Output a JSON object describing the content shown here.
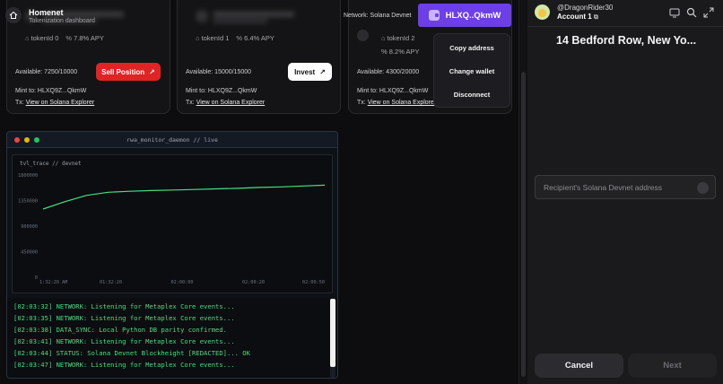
{
  "header": {
    "title": "Homenet",
    "subtitle": "Tokenization dashboard",
    "network_label": "Network: Solana Devnet",
    "wallet_button": "HLXQ..QkmW"
  },
  "wallet_menu": {
    "items": [
      "Copy address",
      "Change wallet",
      "Disconnect"
    ]
  },
  "cards": [
    {
      "token": "tokenId 0",
      "apy": "7.8% APY",
      "available": "Available: 7250/10000",
      "action": "Sell Position",
      "mint_prefix": "Mint to:",
      "mint": "HLXQ9Z...QkmW",
      "tx_prefix": "Tx:",
      "tx_link": "View on Solana Explorer"
    },
    {
      "token": "tokenId 1",
      "apy": "6.4% APY",
      "available": "Available: 15000/15000",
      "action": "Invest",
      "mint_prefix": "Mint to:",
      "mint": "HLXQ9Z...QkmW",
      "tx_prefix": "Tx:",
      "tx_link": "View on Solana Explorer"
    },
    {
      "token": "tokenId 2",
      "apy": "8.2% APY",
      "available": "Available: 4300/20000",
      "action": "",
      "mint_prefix": "Mint to:",
      "mint": "HLXQ9Z...QkmW",
      "tx_prefix": "Tx:",
      "tx_link": "View on Solana Explorer"
    }
  ],
  "terminal": {
    "title": "rwa_monitor_daemon // live",
    "logs": [
      "[02:03:32] NETWORK: Listening for Metaplex Core events...",
      "[02:03:35] NETWORK: Listening for Metaplex Core events...",
      "[02:03:38] DATA_SYNC: Local Python DB parity confirmed.",
      "[02:03:41] NETWORK: Listening for Metaplex Core events...",
      "[02:03:44] STATUS: Solana Devnet Blockheight [REDACTED]... OK",
      "[02:03:47] NETWORK: Listening for Metaplex Core events..."
    ]
  },
  "chart_data": {
    "type": "line",
    "title": "tvl_trace // devnet",
    "xlabel": "",
    "ylabel": "",
    "x_ticks": [
      "1:32:20 AM",
      "01:32:20",
      "02:00:00",
      "02:00:20",
      "02:00:50"
    ],
    "y_ticks": [
      "0",
      "450000",
      "900000",
      "1350000",
      "1800000"
    ],
    "ylim": [
      0,
      1800000
    ],
    "grid": false,
    "color": "#4ade80",
    "series": [
      {
        "values": [
          1200000,
          1330000,
          1440000,
          1495000,
          1512000,
          1525000,
          1535000,
          1545000,
          1555000,
          1565000,
          1580000,
          1590000,
          1605000,
          1620000
        ]
      }
    ]
  },
  "wallet": {
    "user": "@DragonRider30",
    "account": "Account 1",
    "address": "14 Bedford Row, New Yo...",
    "recipient_placeholder": "Recipient's Solana Devnet address",
    "cancel": "Cancel",
    "next": "Next"
  }
}
